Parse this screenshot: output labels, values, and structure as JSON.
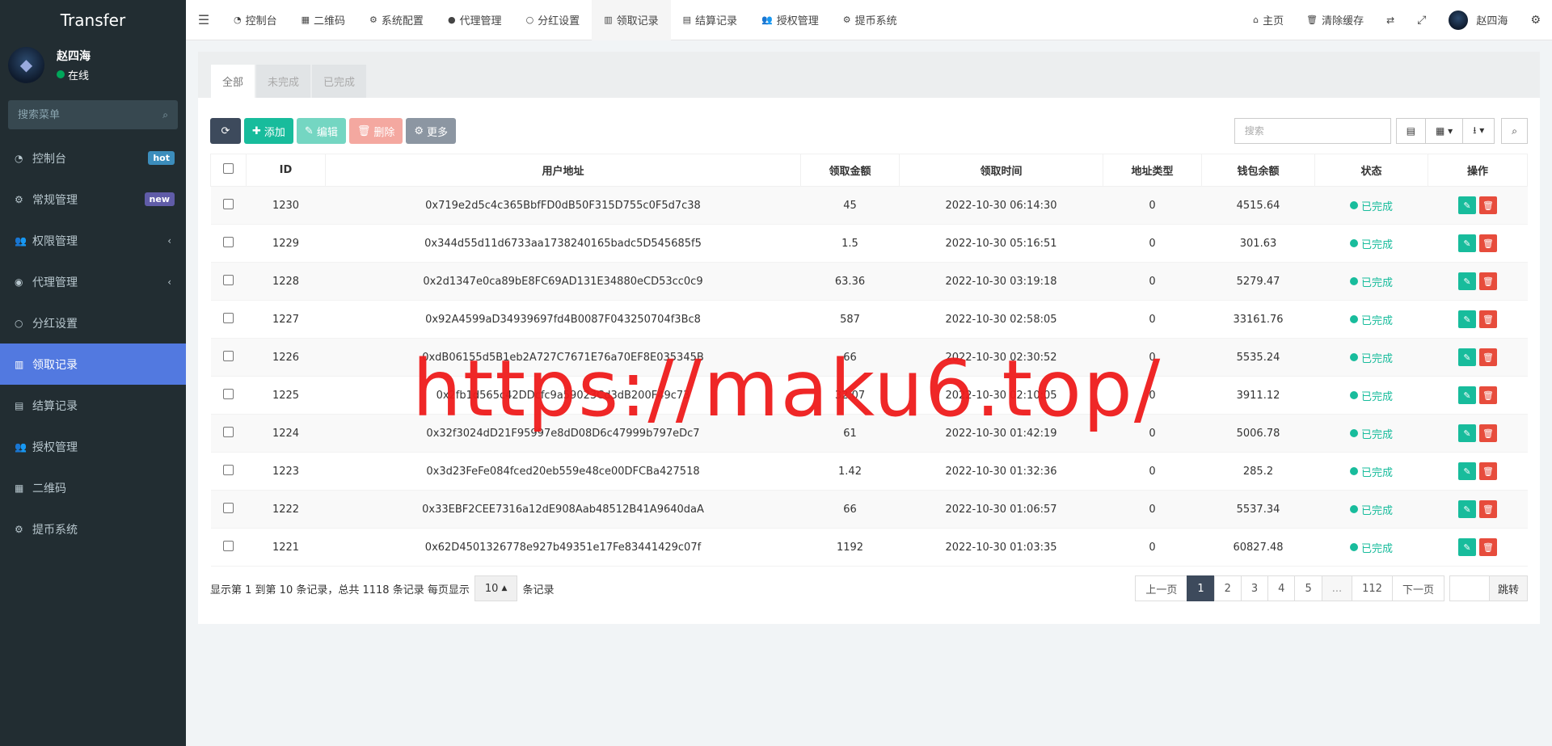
{
  "app": {
    "title": "Transfer"
  },
  "user": {
    "name": "赵四海",
    "status": "在线"
  },
  "sidebar": {
    "search_placeholder": "搜索菜单",
    "items": [
      {
        "label": "控制台",
        "icon": "dashboard-icon",
        "badge": "hot"
      },
      {
        "label": "常规管理",
        "icon": "cogs-icon",
        "badge": "new"
      },
      {
        "label": "权限管理",
        "icon": "group-icon",
        "chevron": "‹"
      },
      {
        "label": "代理管理",
        "icon": "user-circle-icon",
        "chevron": "‹"
      },
      {
        "label": "分红设置",
        "icon": "circle-icon"
      },
      {
        "label": "领取记录",
        "icon": "bar-chart-icon",
        "active": true
      },
      {
        "label": "结算记录",
        "icon": "list-alt-icon"
      },
      {
        "label": "授权管理",
        "icon": "group-icon"
      },
      {
        "label": "二维码",
        "icon": "qrcode-icon"
      },
      {
        "label": "提币系统",
        "icon": "gear-icon"
      }
    ]
  },
  "topnav": {
    "items": [
      "控制台",
      "二维码",
      "系统配置",
      "代理管理",
      "分红设置",
      "领取记录",
      "结算记录",
      "授权管理",
      "提币系统"
    ],
    "right": {
      "home": "主页",
      "clear_cache": "清除缓存",
      "user": "赵四海"
    }
  },
  "tabs": [
    "全部",
    "未完成",
    "已完成"
  ],
  "toolbar": {
    "add": "添加",
    "edit": "编辑",
    "delete": "删除",
    "more": "更多",
    "search_placeholder": "搜索"
  },
  "table": {
    "headers": [
      "ID",
      "用户地址",
      "领取金额",
      "领取时间",
      "地址类型",
      "钱包余额",
      "状态",
      "操作"
    ],
    "rows": [
      {
        "id": "1230",
        "address": "0x719e2d5c4c365BbfFD0dB50F315D755c0F5d7c38",
        "amount": "45",
        "time": "2022-10-30 06:14:30",
        "type": "0",
        "balance": "4515.64",
        "status": "已完成"
      },
      {
        "id": "1229",
        "address": "0x344d55d11d6733aa1738240165badc5D545685f5",
        "amount": "1.5",
        "time": "2022-10-30 05:16:51",
        "type": "0",
        "balance": "301.63",
        "status": "已完成"
      },
      {
        "id": "1228",
        "address": "0x2d1347e0ca89bE8FC69AD131E34880eCD53cc0c9",
        "amount": "63.36",
        "time": "2022-10-30 03:19:18",
        "type": "0",
        "balance": "5279.47",
        "status": "已完成"
      },
      {
        "id": "1227",
        "address": "0x92A4599aD34939697fd4B0087F043250704f3Bc8",
        "amount": "587",
        "time": "2022-10-30 02:58:05",
        "type": "0",
        "balance": "33161.76",
        "status": "已完成"
      },
      {
        "id": "1226",
        "address": "0xdB06155d5B1eb2A727C7671E76a70EF8E035345B",
        "amount": "66",
        "time": "2022-10-30 02:30:52",
        "type": "0",
        "balance": "5535.24",
        "status": "已完成"
      },
      {
        "id": "1225",
        "address": "0x2fb1d565c42DDcfc9a59023Cd3dB200F49c73",
        "amount": "32.07",
        "time": "2022-10-30 02:10:05",
        "type": "0",
        "balance": "3911.12",
        "status": "已完成"
      },
      {
        "id": "1224",
        "address": "0x32f3024dD21F95997e8dD08D6c47999b797eDc7",
        "amount": "61",
        "time": "2022-10-30 01:42:19",
        "type": "0",
        "balance": "5006.78",
        "status": "已完成"
      },
      {
        "id": "1223",
        "address": "0x3d23FeFe084fced20eb559e48ce00DFCBa427518",
        "amount": "1.42",
        "time": "2022-10-30 01:32:36",
        "type": "0",
        "balance": "285.2",
        "status": "已完成"
      },
      {
        "id": "1222",
        "address": "0x33EBF2CEE7316a12dE908Aab48512B41A9640daA",
        "amount": "66",
        "time": "2022-10-30 01:06:57",
        "type": "0",
        "balance": "5537.34",
        "status": "已完成"
      },
      {
        "id": "1221",
        "address": "0x62D4501326778e927b49351e17Fe83441429c07f",
        "amount": "1192",
        "time": "2022-10-30 01:03:35",
        "type": "0",
        "balance": "60827.48",
        "status": "已完成"
      }
    ]
  },
  "footer": {
    "summary_prefix": "显示第 1 到第 10 条记录，总共 1118 条记录 每页显示",
    "page_size": "10",
    "summary_suffix": "条记录",
    "prev": "上一页",
    "pages": [
      "1",
      "2",
      "3",
      "4",
      "5",
      "...",
      "112"
    ],
    "next": "下一页",
    "jump": "跳转"
  },
  "watermark": "https://maku6.top/",
  "colors": {
    "sidebar_bg": "#222d32",
    "active": "#5279e0",
    "success": "#18bc9c",
    "danger": "#e74c3c"
  }
}
